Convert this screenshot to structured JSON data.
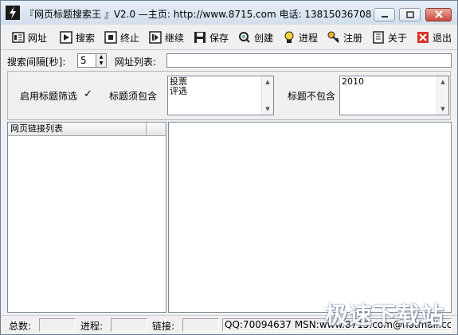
{
  "window": {
    "title": "『网页标题搜索王 』V2.0 —主页: http://www.8715.com 电话: 13815036708"
  },
  "toolbar": [
    {
      "label": "网址",
      "icon": "url-icon"
    },
    {
      "label": "搜索",
      "icon": "play-icon"
    },
    {
      "label": "终止",
      "icon": "stop-icon"
    },
    {
      "label": "继续",
      "icon": "resume-icon"
    },
    {
      "label": "保存",
      "icon": "floppy-icon"
    },
    {
      "label": "创建",
      "icon": "create-icon"
    },
    {
      "label": "进程",
      "icon": "bulb-icon"
    },
    {
      "label": "注册",
      "icon": "key-icon"
    },
    {
      "label": "关于",
      "icon": "book-icon"
    },
    {
      "label": "退出",
      "icon": "exit-icon"
    }
  ],
  "search": {
    "interval_label": "搜索间隔[秒]:",
    "interval_value": "5",
    "url_list_label": "网址列表:",
    "url_list_value": ""
  },
  "filter": {
    "enable_label": "启用标题筛选",
    "enable_checked": "✓",
    "must_include_label": "标题须包含",
    "must_include_lines": [
      "投票",
      "评选"
    ],
    "exclude_label": "标题不包含",
    "exclude_lines": [
      "2010"
    ]
  },
  "links_panel": {
    "header": "网页链接列表"
  },
  "status": {
    "total_label": "总数:",
    "total_value": "",
    "progress_label": "进程:",
    "progress_value": "",
    "link_label": "链接:",
    "link_value": "",
    "contact": "QQ:70094637 MSN:www.8715.com@hotmail.cc"
  },
  "watermark": "极速下载站"
}
